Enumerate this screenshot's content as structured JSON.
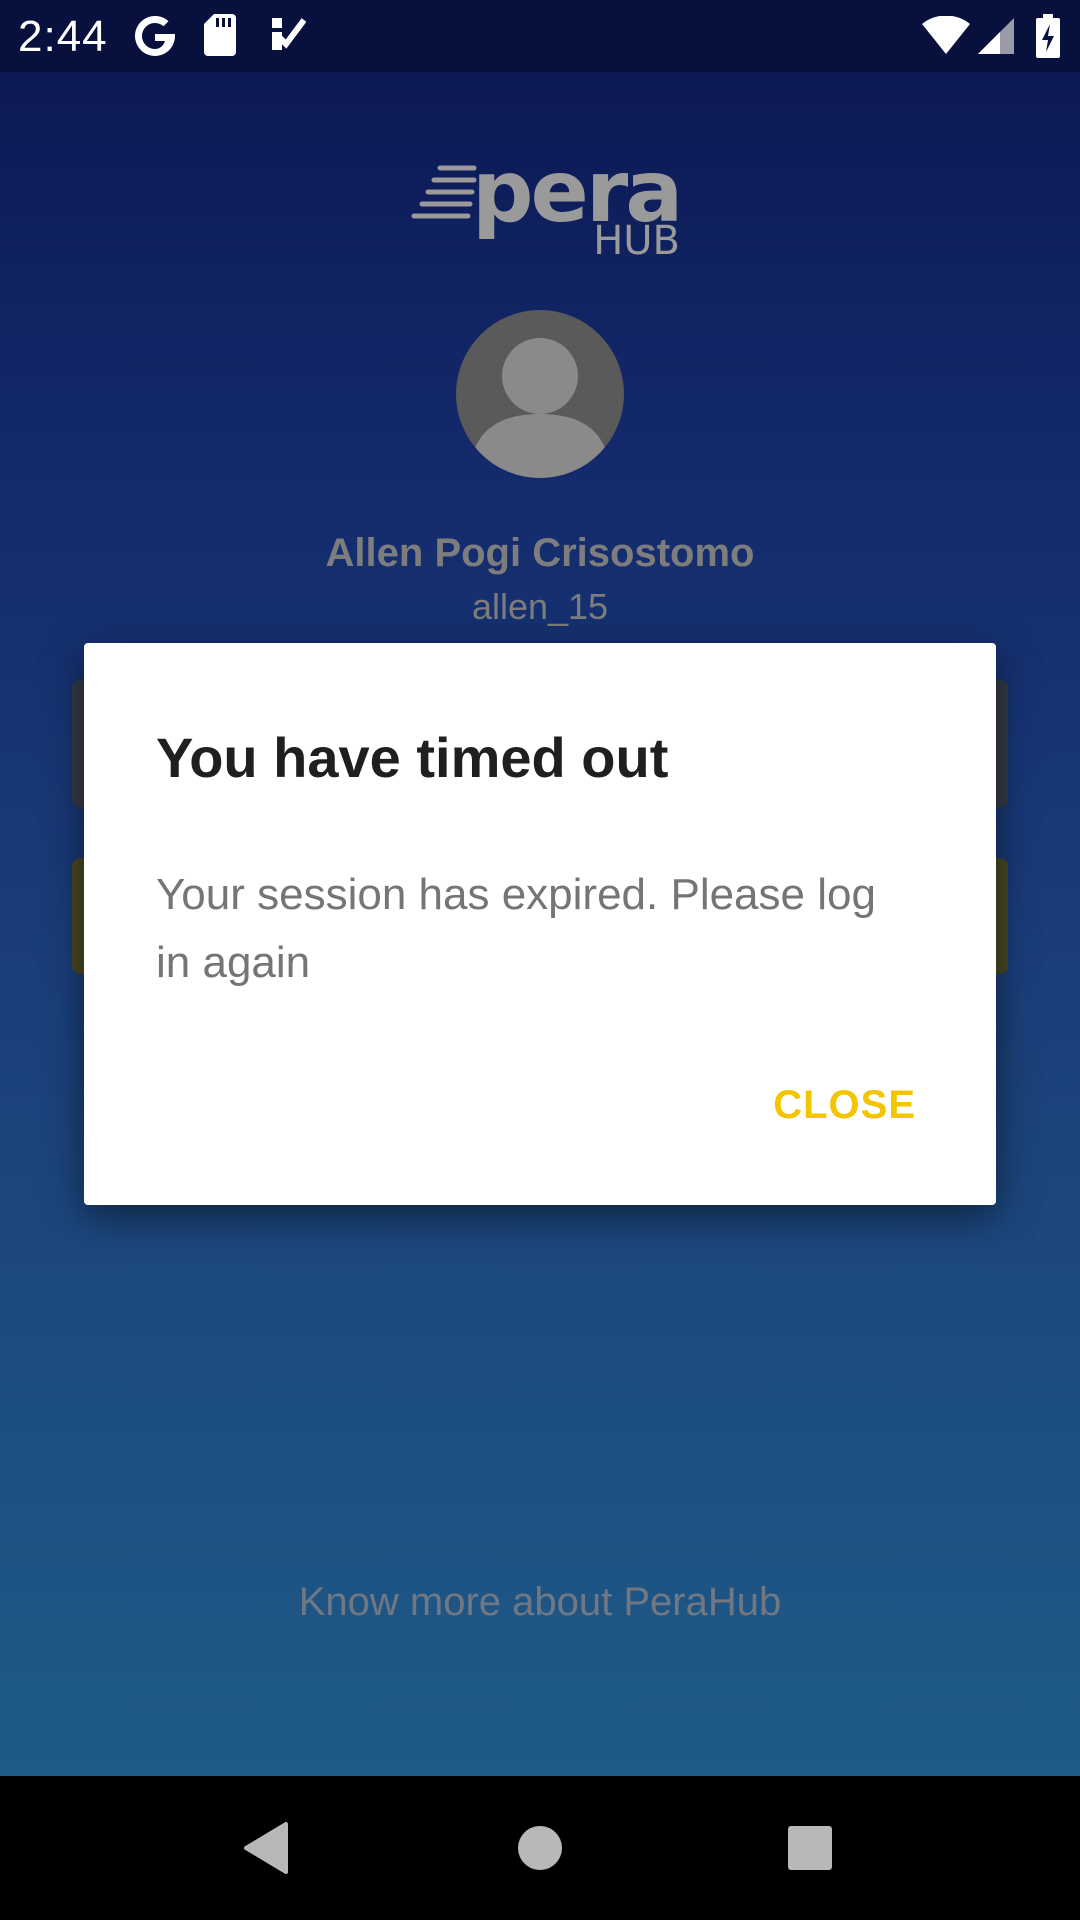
{
  "status_bar": {
    "time": "2:44",
    "icons": [
      "google-icon",
      "sd-card-icon",
      "task-check-icon",
      "wifi-icon",
      "signal-icon",
      "battery-charging-icon"
    ]
  },
  "logo": {
    "wordmark": "pera",
    "sub": "HUB"
  },
  "profile": {
    "name": "Allen Pogi Crisostomo",
    "username": "allen_15"
  },
  "footer": {
    "link": "Know more about PeraHub"
  },
  "dialog": {
    "title": "You have timed out",
    "message": "Your session has expired. Please log in again",
    "close_label": "CLOSE"
  },
  "nav_bar": {
    "icons": [
      "back-icon",
      "home-icon",
      "recents-icon"
    ]
  },
  "colors": {
    "accent": "#f5c400",
    "background_top": "#0b1650",
    "background_bottom": "#1f5b86"
  }
}
